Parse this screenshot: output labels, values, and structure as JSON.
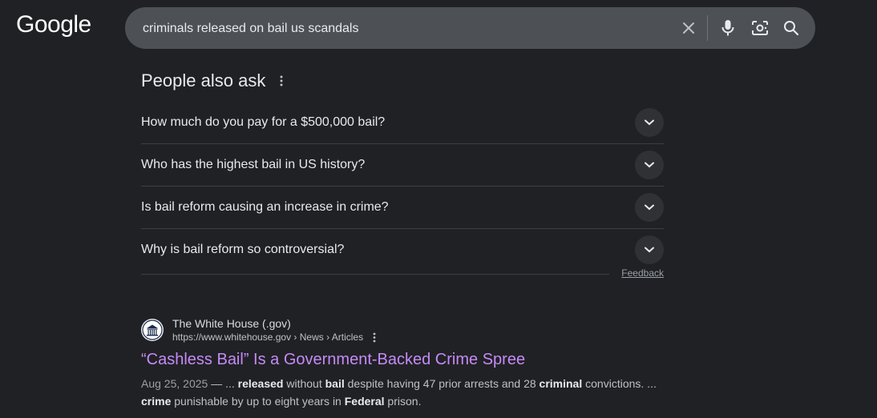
{
  "header": {
    "logo_text": "Google",
    "search": {
      "query": "criminals released on bail us scandals",
      "icons": [
        "close-icon",
        "microphone-icon",
        "camera-lens-icon",
        "search-icon"
      ]
    }
  },
  "people_also_ask": {
    "title": "People also ask",
    "questions": [
      "How much do you pay for a $500,000 bail?",
      "Who has the highest bail in US history?",
      "Is bail reform causing an increase in crime?",
      "Why is bail reform so controversial?"
    ],
    "feedback_label": "Feedback"
  },
  "result": {
    "site_name": "The White House (.gov)",
    "url": "https://www.whitehouse.gov › News › Articles",
    "title": "“Cashless Bail” Is a Government-Backed Crime Spree",
    "date": "Aug 25, 2025",
    "snippet_parts": [
      {
        "t": " — ... ",
        "b": false
      },
      {
        "t": "released",
        "b": true
      },
      {
        "t": " without ",
        "b": false
      },
      {
        "t": "bail",
        "b": true
      },
      {
        "t": " despite having 47 prior arrests and 28 ",
        "b": false
      },
      {
        "t": "criminal",
        "b": true
      },
      {
        "t": " convictions. ... ",
        "b": false
      },
      {
        "t": "crime",
        "b": true
      },
      {
        "t": " punishable by up to eight years in ",
        "b": false
      },
      {
        "t": "Federal",
        "b": true
      },
      {
        "t": " prison.",
        "b": false
      }
    ]
  },
  "colors": {
    "background": "#202124",
    "search_box": "#4d5156",
    "visited_link": "#c58af9"
  }
}
